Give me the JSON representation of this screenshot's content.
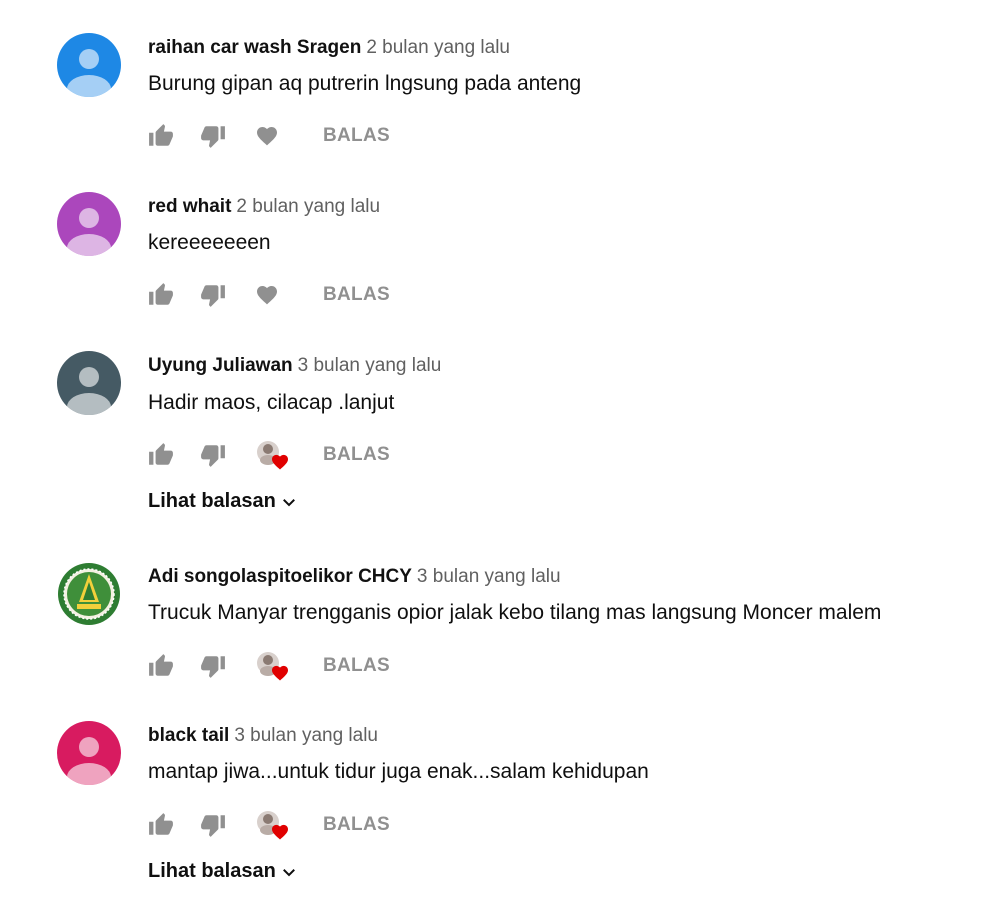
{
  "reply_label": "BALAS",
  "view_replies_label": "Lihat balasan",
  "comments": [
    {
      "author": "raihan car wash Sragen",
      "time": "2 bulan yang lalu",
      "text": "Burung gipan aq putrerin lngsung pada anteng",
      "avatar_color": "#1e88e5",
      "creator_heart": false,
      "has_replies": false
    },
    {
      "author": "red whait",
      "time": "2 bulan yang lalu",
      "text": "kereeeeeeen",
      "avatar_color": "#ab47bc",
      "creator_heart": false,
      "has_replies": false
    },
    {
      "author": "Uyung Juliawan",
      "time": "3 bulan yang lalu",
      "text": "Hadir maos, cilacap .lanjut",
      "avatar_color": "#455a64",
      "creator_heart": true,
      "has_replies": true
    },
    {
      "author": "Adi songolaspitoelikor CHCY",
      "time": "3 bulan yang lalu",
      "text": "Trucuk Manyar trengganis opior jalak kebo tilang mas langsung Moncer malem",
      "avatar_color": "#2e7d32",
      "creator_heart": true,
      "has_replies": false
    },
    {
      "author": "black tail",
      "time": "3 bulan yang lalu",
      "text": "mantap jiwa...untuk tidur juga enak...salam kehidupan",
      "avatar_color": "#d81b60",
      "creator_heart": true,
      "has_replies": true
    }
  ]
}
